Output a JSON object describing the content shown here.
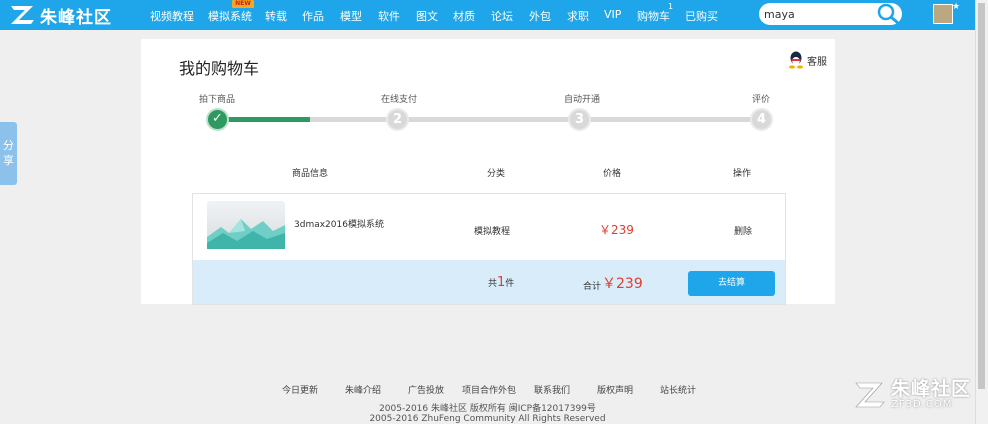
{
  "header": {
    "logo_text": "朱峰社区",
    "nav": [
      {
        "label": "视频教程"
      },
      {
        "label": "模拟系统"
      },
      {
        "label": "转载"
      },
      {
        "label": "作品"
      },
      {
        "label": "模型"
      },
      {
        "label": "软件"
      },
      {
        "label": "图文"
      },
      {
        "label": "材质"
      },
      {
        "label": "论坛"
      },
      {
        "label": "外包"
      },
      {
        "label": "求职"
      },
      {
        "label": "VIP"
      },
      {
        "label": "购物车"
      },
      {
        "label": "已购买"
      }
    ],
    "new_badge": "NEW",
    "cart_count": "1",
    "search_value": "maya"
  },
  "share_label": "分享",
  "cart": {
    "title": "我的购物车",
    "report_label": "客服",
    "steps": [
      {
        "label": "拍下商品",
        "number": "✓",
        "done": true
      },
      {
        "label": "在线支付",
        "number": "2"
      },
      {
        "label": "自动开通",
        "number": "3"
      },
      {
        "label": "评价",
        "number": "4"
      }
    ],
    "progress_fraction": 0.17,
    "columns": [
      "商品信息",
      "分类",
      "价格",
      "操作"
    ],
    "items": [
      {
        "name": "3dmax2016模拟系统",
        "category": "模拟教程",
        "price": "￥239",
        "action": "删除"
      }
    ],
    "summary": {
      "count_prefix": "共",
      "count": "1",
      "count_suffix": "件",
      "total_label": "合计",
      "total": "￥239",
      "checkout_label": "去结算"
    }
  },
  "footer": {
    "links": [
      "今日更新",
      "朱峰介绍",
      "广告投放",
      "项目合作外包",
      "联系我们",
      "版权声明",
      "站长统计"
    ],
    "copyright": "2005-2016 朱峰社区 版权所有 闽ICP备12017399号",
    "copyright_en": "2005-2016 ZhuFeng Community All Rights Reserved"
  },
  "watermark": {
    "title": "朱峰社区",
    "subtitle": "ZF3D.COM"
  },
  "colors": {
    "brand_blue": "#1fa5ea",
    "step_done": "#2c9a61",
    "price_red": "#e43b2b",
    "summary_bg": "#d8ecfa"
  }
}
